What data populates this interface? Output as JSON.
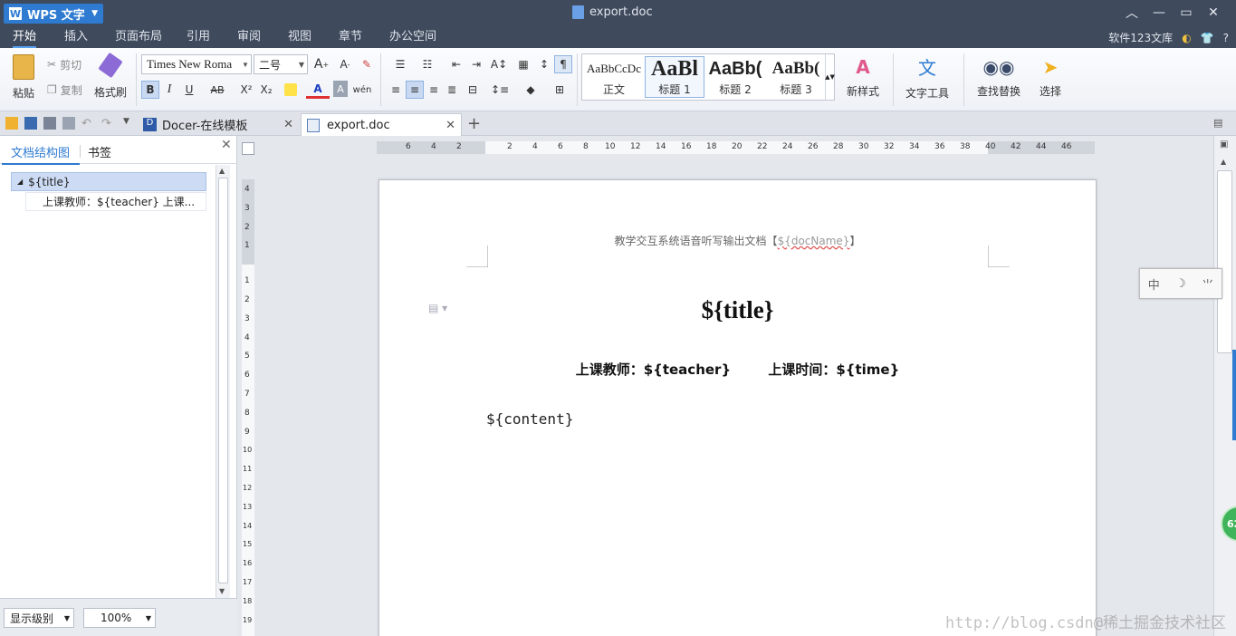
{
  "titlebar": {
    "app_label": "WPS 文字",
    "doc_title": "export.doc"
  },
  "menu": {
    "tabs": [
      "开始",
      "插入",
      "页面布局",
      "引用",
      "审阅",
      "视图",
      "章节",
      "办公空间"
    ],
    "user": "软件123文库",
    "help": "?"
  },
  "ribbon": {
    "paste": "粘贴",
    "cut": "剪切",
    "copy": "复制",
    "format_painter": "格式刷",
    "font_name": "Times New Roma",
    "font_size": "二号",
    "bold": "B",
    "italic": "I",
    "underline": "U",
    "strikethrough": "AB",
    "superscript": "X²",
    "subscript": "X₂",
    "font_color": "A",
    "styles": [
      {
        "sample": "AaBbCcDc",
        "label": "正文"
      },
      {
        "sample": "AaBl",
        "label": "标题 1"
      },
      {
        "sample": "AaBb(",
        "label": "标题 2"
      },
      {
        "sample": "AaBb(",
        "label": "标题 3"
      }
    ],
    "new_style": "新样式",
    "text_tools": "文字工具",
    "find_replace": "查找替换",
    "select": "选择"
  },
  "tabs": [
    {
      "label": "Docer-在线模板",
      "active": false
    },
    {
      "label": "export.doc",
      "active": true
    }
  ],
  "left_panel": {
    "tab_outline": "文档结构图",
    "tab_bookmark": "书签",
    "tree_root": "${title}",
    "tree_child": "上课教师：${teacher}   上课...",
    "level_select": "显示级别",
    "zoom_select": "100%"
  },
  "ruler": {
    "h_ticks": [
      "6",
      "4",
      "2",
      "2",
      "4",
      "6",
      "8",
      "10",
      "12",
      "14",
      "16",
      "18",
      "20",
      "22",
      "24",
      "26",
      "28",
      "30",
      "32",
      "34",
      "36",
      "38",
      "40",
      "42",
      "44",
      "46"
    ],
    "v_ticks": [
      "4",
      "3",
      "2",
      "1",
      "1",
      "2",
      "3",
      "4",
      "5",
      "6",
      "7",
      "8",
      "9",
      "10",
      "11",
      "12",
      "13",
      "14",
      "15",
      "16",
      "17",
      "18",
      "19"
    ]
  },
  "document": {
    "header_prefix": "教学交互系统语音听写输出文档【",
    "header_var": "${docName}",
    "header_suffix": "】",
    "title": "${title}",
    "teacher": "上课教师：${teacher}",
    "time": "上课时间：${time}",
    "content": "${content}"
  },
  "ime": {
    "lang": "中",
    "moon": "☽",
    "punct": "⺌"
  },
  "badge": "62",
  "watermark": "http://blog.csdn@稀土掘金技术社区",
  "colors": {
    "titlebar": "#3f4a5c",
    "accent": "#2e7bd1",
    "tree_selected": "#cddcf4"
  }
}
